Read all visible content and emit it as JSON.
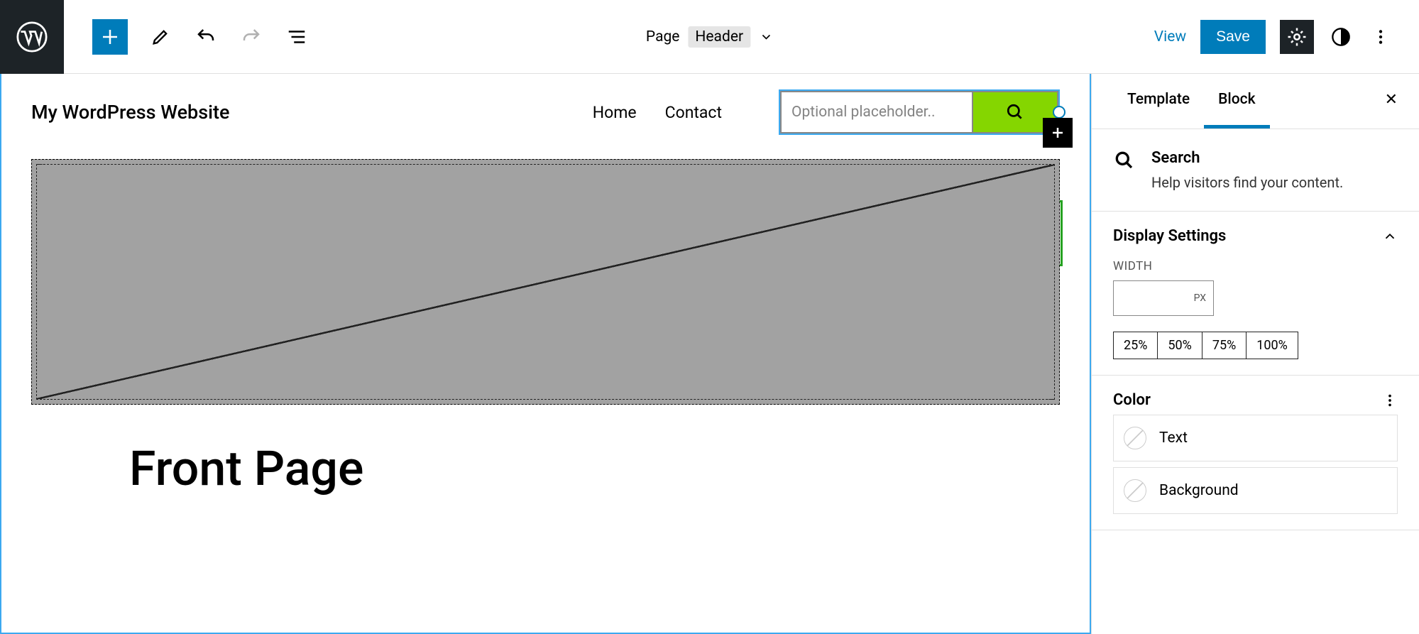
{
  "topbar": {
    "doc_type": "Page",
    "doc_name": "Header",
    "view": "View",
    "save": "Save"
  },
  "header": {
    "site_title": "My WordPress Website",
    "nav": [
      "Home",
      "Contact"
    ],
    "search_placeholder": "Optional placeholder.."
  },
  "content": {
    "page_title": "Front Page"
  },
  "sidebar": {
    "tabs": {
      "template": "Template",
      "block": "Block"
    },
    "block": {
      "name": "Search",
      "desc": "Help visitors find your content."
    },
    "display_settings": {
      "title": "Display Settings",
      "width_label": "WIDTH",
      "width_unit": "PX",
      "presets": [
        "25%",
        "50%",
        "75%",
        "100%"
      ]
    },
    "color": {
      "title": "Color",
      "text": "Text",
      "background": "Background"
    }
  }
}
